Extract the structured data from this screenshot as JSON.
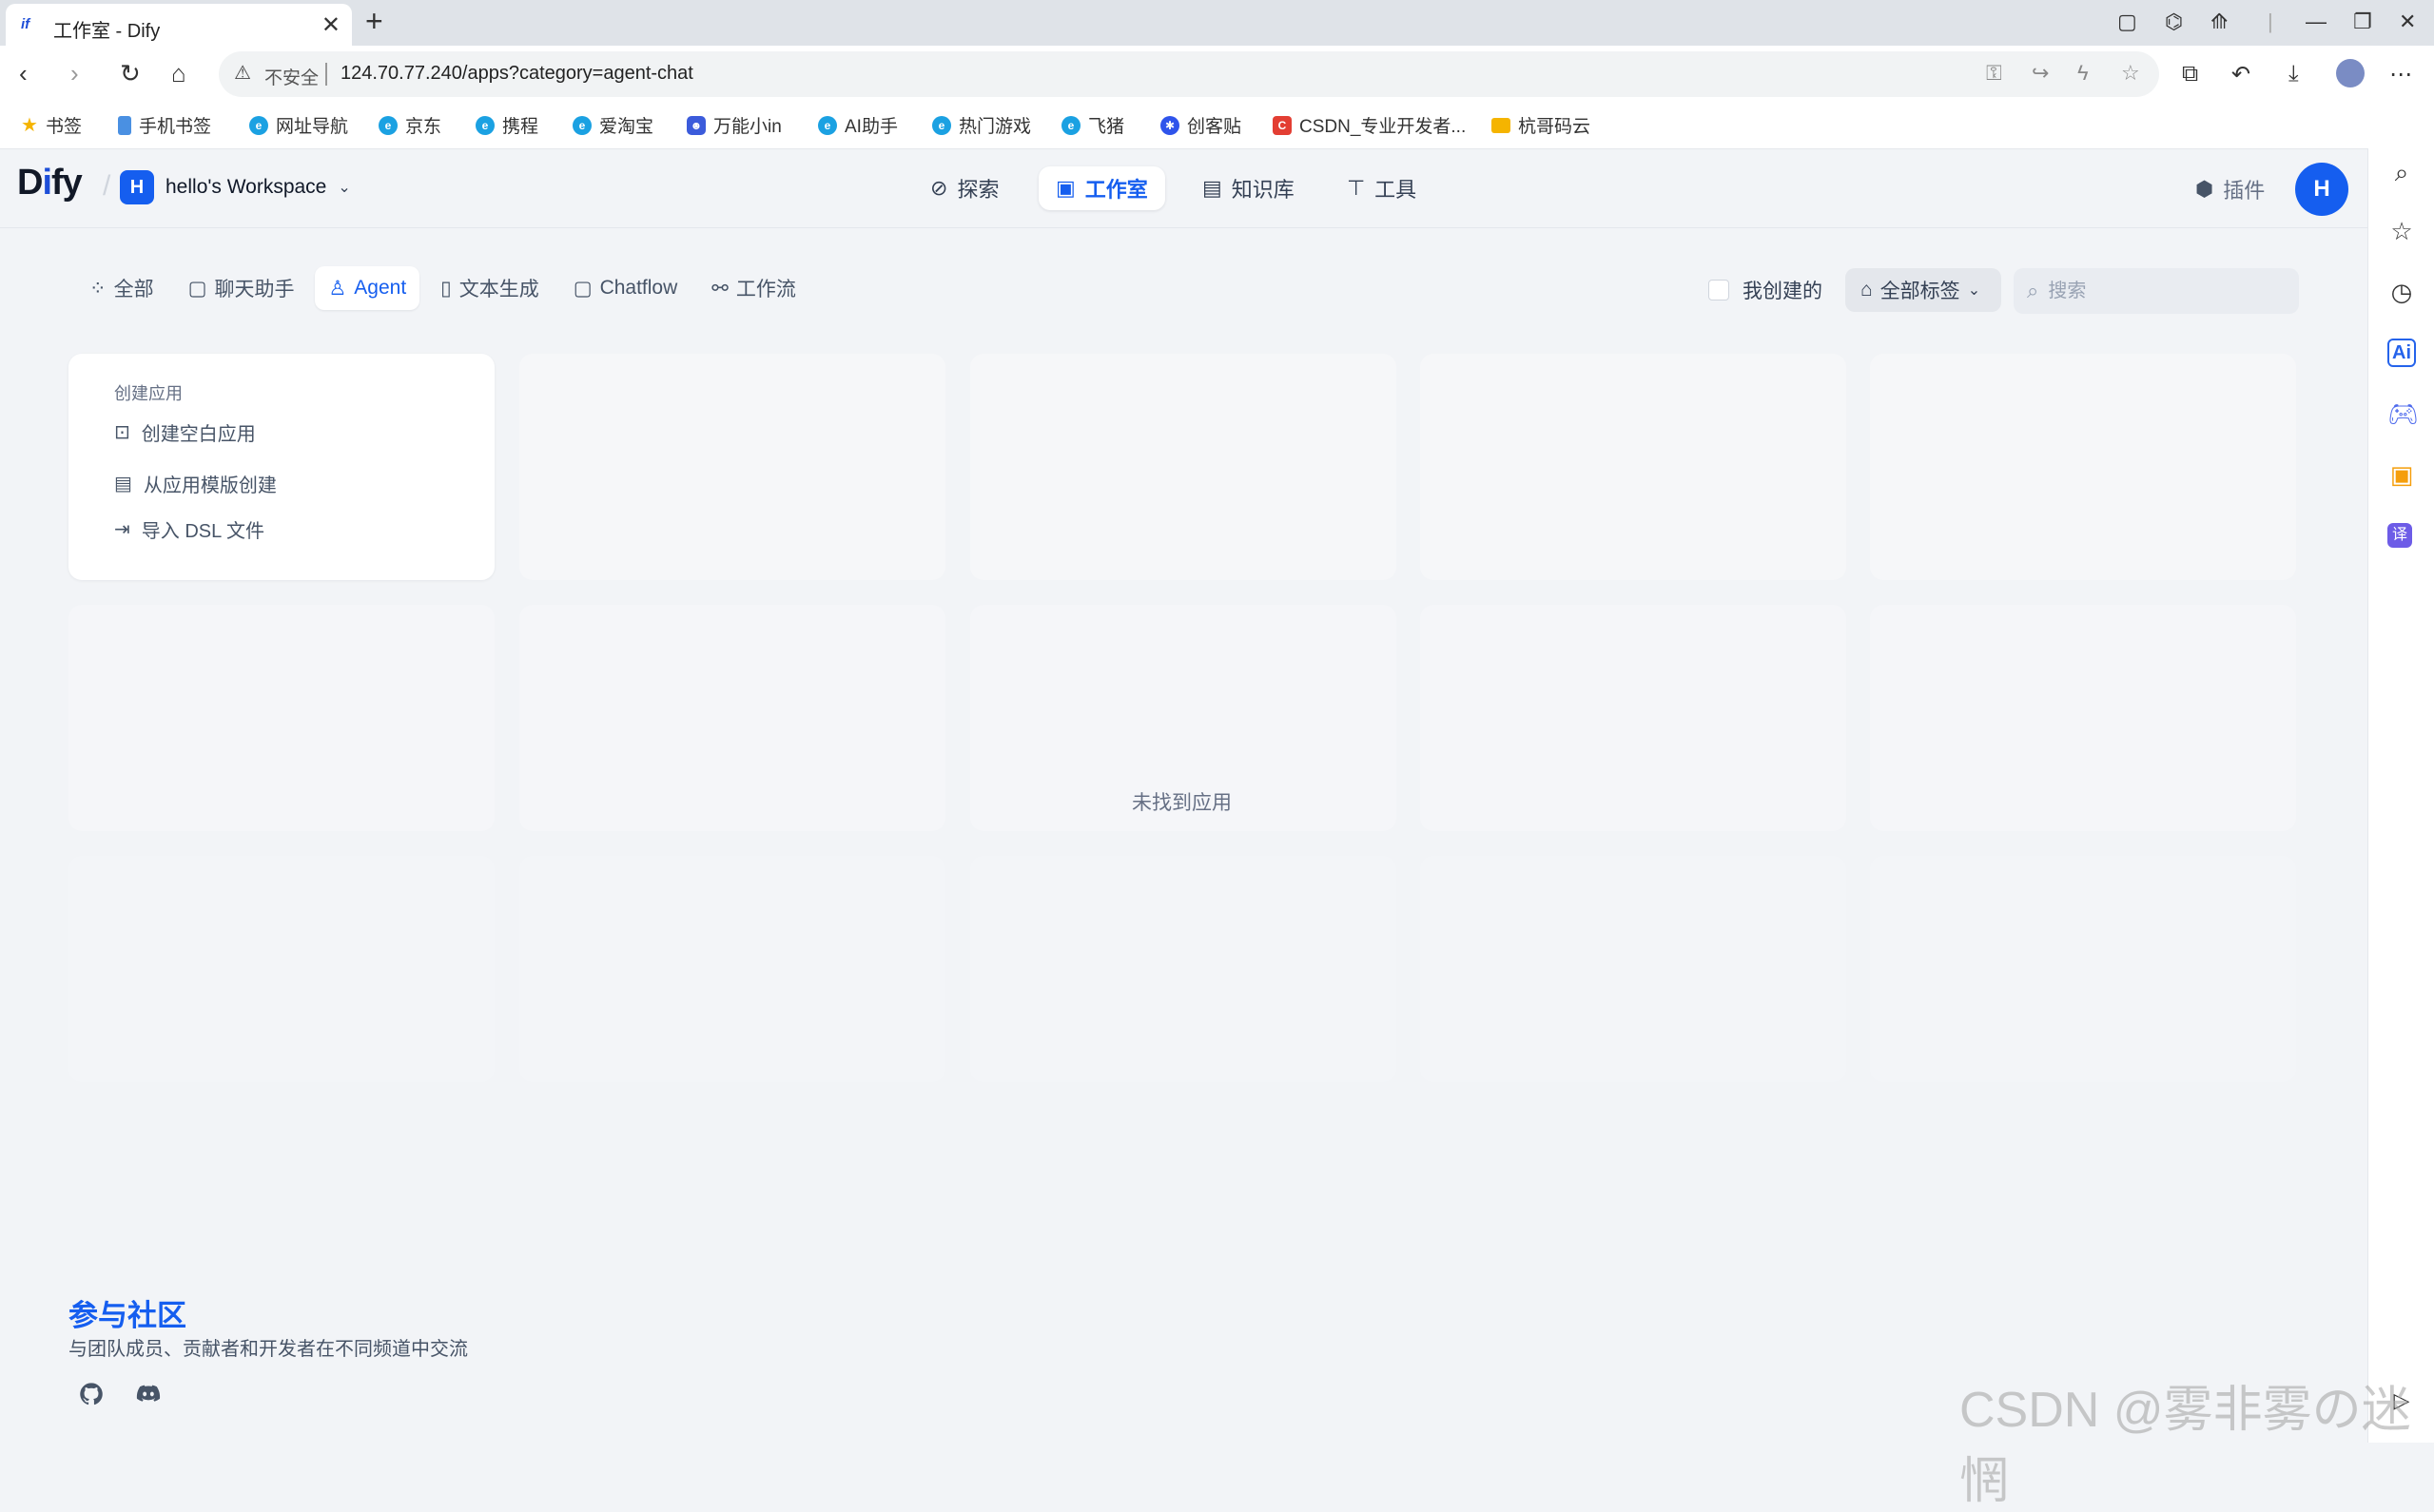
{
  "browser": {
    "tab_title": "工作室 - Dify",
    "favicon_text": "if",
    "url_security": "不安全",
    "url": "124.70.77.240/apps?category=agent-chat",
    "bookmarks": [
      {
        "label": "书签",
        "icon": "star-icon",
        "color": "#f5b400"
      },
      {
        "label": "手机书签",
        "icon": "phone-icon",
        "color": "#4a90e2"
      },
      {
        "label": "网址导航",
        "icon": "e-icon",
        "color": "#1ba1e2"
      },
      {
        "label": "京东",
        "icon": "e-icon",
        "color": "#1ba1e2"
      },
      {
        "label": "携程",
        "icon": "e-icon",
        "color": "#1ba1e2"
      },
      {
        "label": "爱淘宝",
        "icon": "e-icon",
        "color": "#1ba1e2"
      },
      {
        "label": "万能小in",
        "icon": "robot-icon",
        "color": "#3b5bdb"
      },
      {
        "label": "AI助手",
        "icon": "e-icon",
        "color": "#1ba1e2"
      },
      {
        "label": "热门游戏",
        "icon": "e-icon",
        "color": "#1ba1e2"
      },
      {
        "label": "飞猪",
        "icon": "e-icon",
        "color": "#1ba1e2"
      },
      {
        "label": "创客贴",
        "icon": "gear-icon",
        "color": "#2f54eb"
      },
      {
        "label": "CSDN_专业开发者...",
        "icon": "csdn-icon",
        "color": "#e33e33"
      },
      {
        "label": "杭哥码云",
        "icon": "folder-icon",
        "color": "#f5b400"
      }
    ]
  },
  "header": {
    "logo": "Dify",
    "workspace_initial": "H",
    "workspace_name": "hello's Workspace",
    "nav": [
      {
        "label": "探索",
        "icon": "compass-icon"
      },
      {
        "label": "工作室",
        "icon": "robot-icon"
      },
      {
        "label": "知识库",
        "icon": "book-icon"
      },
      {
        "label": "工具",
        "icon": "hammer-icon"
      }
    ],
    "plugin_label": "插件",
    "user_initial": "H"
  },
  "filters": {
    "tabs": [
      {
        "label": "全部",
        "icon": "grid-icon"
      },
      {
        "label": "聊天助手",
        "icon": "chat-icon"
      },
      {
        "label": "Agent",
        "icon": "agent-icon"
      },
      {
        "label": "文本生成",
        "icon": "doc-icon"
      },
      {
        "label": "Chatflow",
        "icon": "chatflow-icon"
      },
      {
        "label": "工作流",
        "icon": "workflow-icon"
      }
    ],
    "active_tab": "Agent",
    "mine_label": "我创建的",
    "tags_label": "全部标签",
    "search_placeholder": "搜索"
  },
  "create": {
    "heading": "创建应用",
    "items": [
      {
        "label": "创建空白应用",
        "icon": "file-plus-icon"
      },
      {
        "label": "从应用模版创建",
        "icon": "template-icon"
      },
      {
        "label": "导入 DSL 文件",
        "icon": "import-icon"
      }
    ]
  },
  "empty_text": "未找到应用",
  "community": {
    "title": "参与社区",
    "subtitle": "与团队成员、贡献者和开发者在不同频道中交流"
  },
  "watermark": "CSDN @雾非雾の迷惘",
  "colors": {
    "primary": "#155eef",
    "page_bg": "#f2f4f7"
  }
}
